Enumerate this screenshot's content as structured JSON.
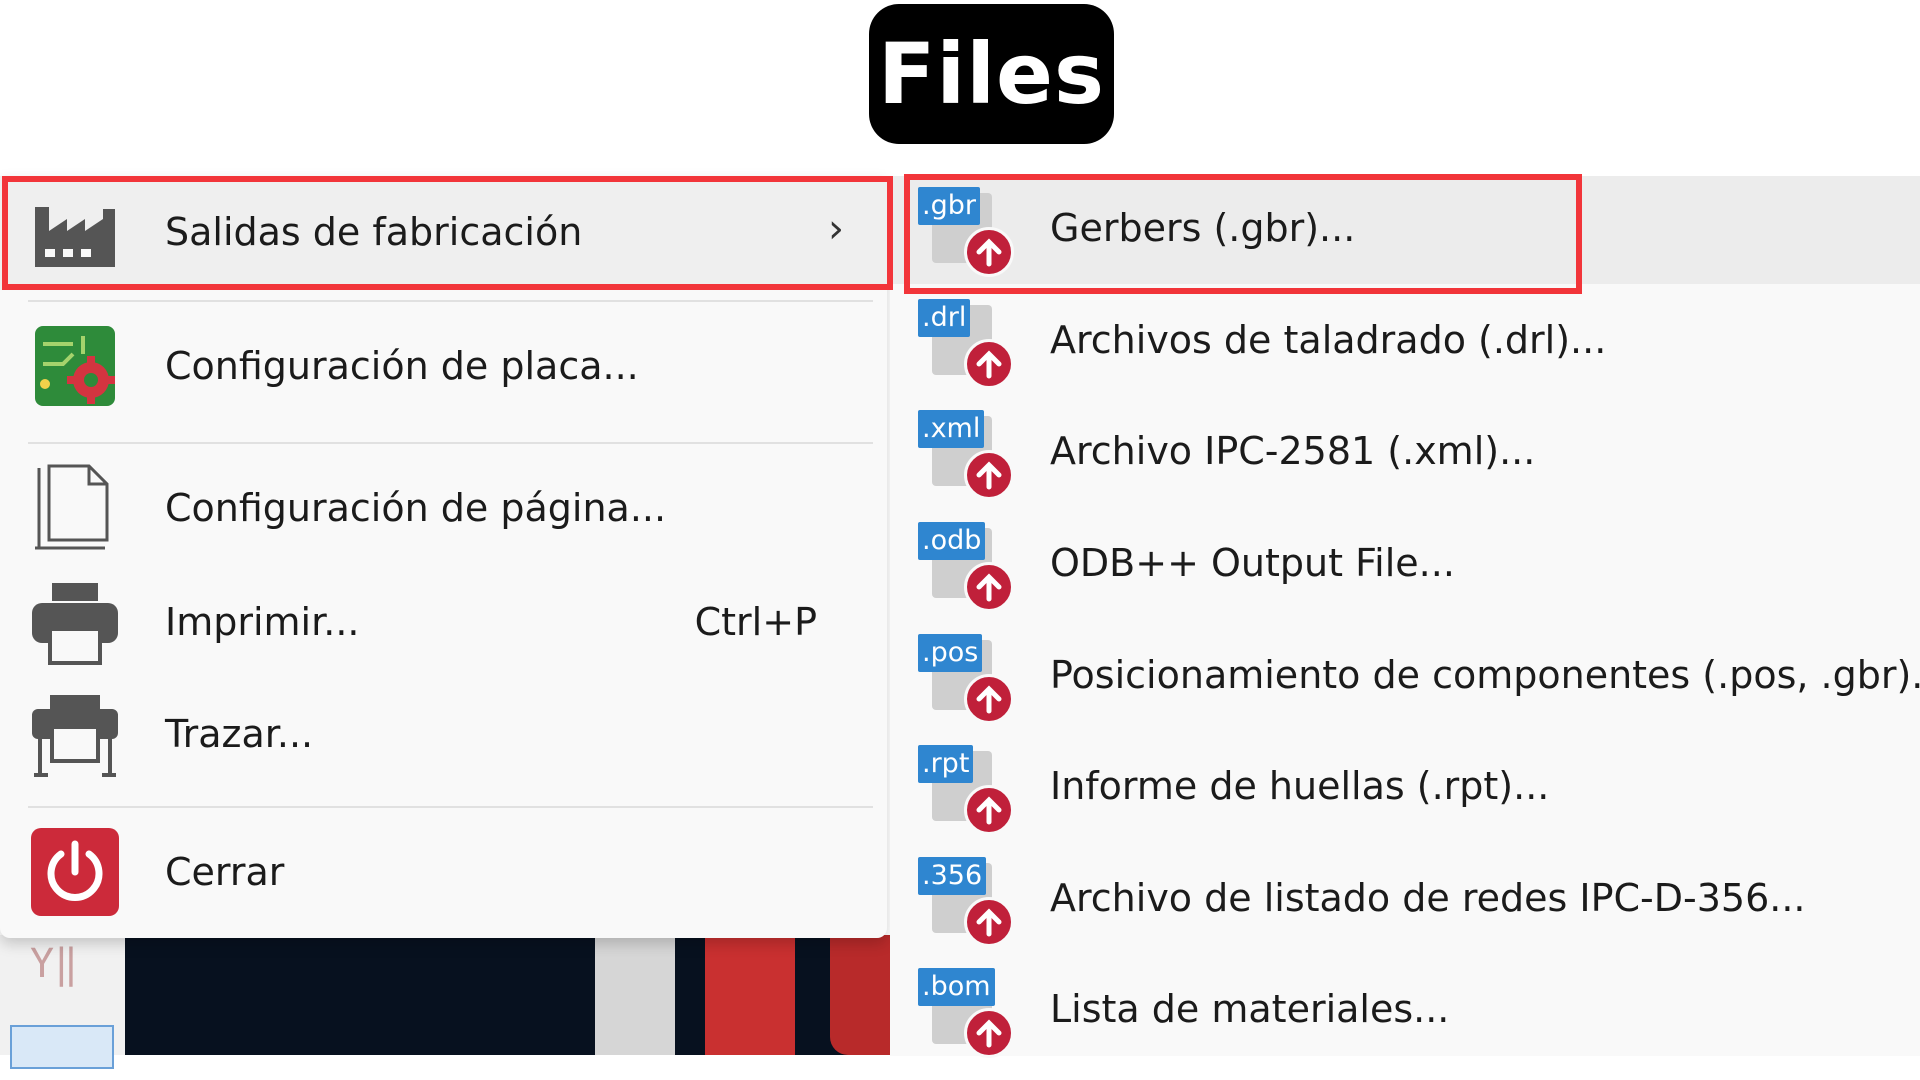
{
  "title": "Files",
  "file_menu": {
    "items": [
      {
        "label": "Salidas de fabricación",
        "icon": "factory-icon",
        "has_submenu": true
      },
      {
        "label": "Configuración de placa...",
        "icon": "board-setup-icon"
      },
      {
        "label": "Configuración de página...",
        "icon": "page-setup-icon"
      },
      {
        "label": "Imprimir...",
        "icon": "printer-icon",
        "shortcut": "Ctrl+P"
      },
      {
        "label": "Trazar...",
        "icon": "plotter-icon"
      },
      {
        "label": "Cerrar",
        "icon": "power-icon"
      }
    ]
  },
  "submenu": {
    "items": [
      {
        "ext": ".gbr",
        "label": "Gerbers (.gbr)..."
      },
      {
        "ext": ".drl",
        "label": "Archivos de taladrado (.drl)..."
      },
      {
        "ext": ".xml",
        "label": "Archivo IPC-2581 (.xml)..."
      },
      {
        "ext": ".odb",
        "label": "ODB++ Output File..."
      },
      {
        "ext": ".pos",
        "label": "Posicionamiento de componentes (.pos, .gbr)..."
      },
      {
        "ext": ".rpt",
        "label": "Informe de huellas (.rpt)..."
      },
      {
        "ext": ".356",
        "label": "Archivo de listado de redes IPC-D-356..."
      },
      {
        "ext": ".bom",
        "label": "Lista de materiales..."
      }
    ]
  },
  "colors": {
    "highlight_border": "#f2353a",
    "ext_badge": "#2f86d0",
    "export_arrow": "#c0203a"
  }
}
